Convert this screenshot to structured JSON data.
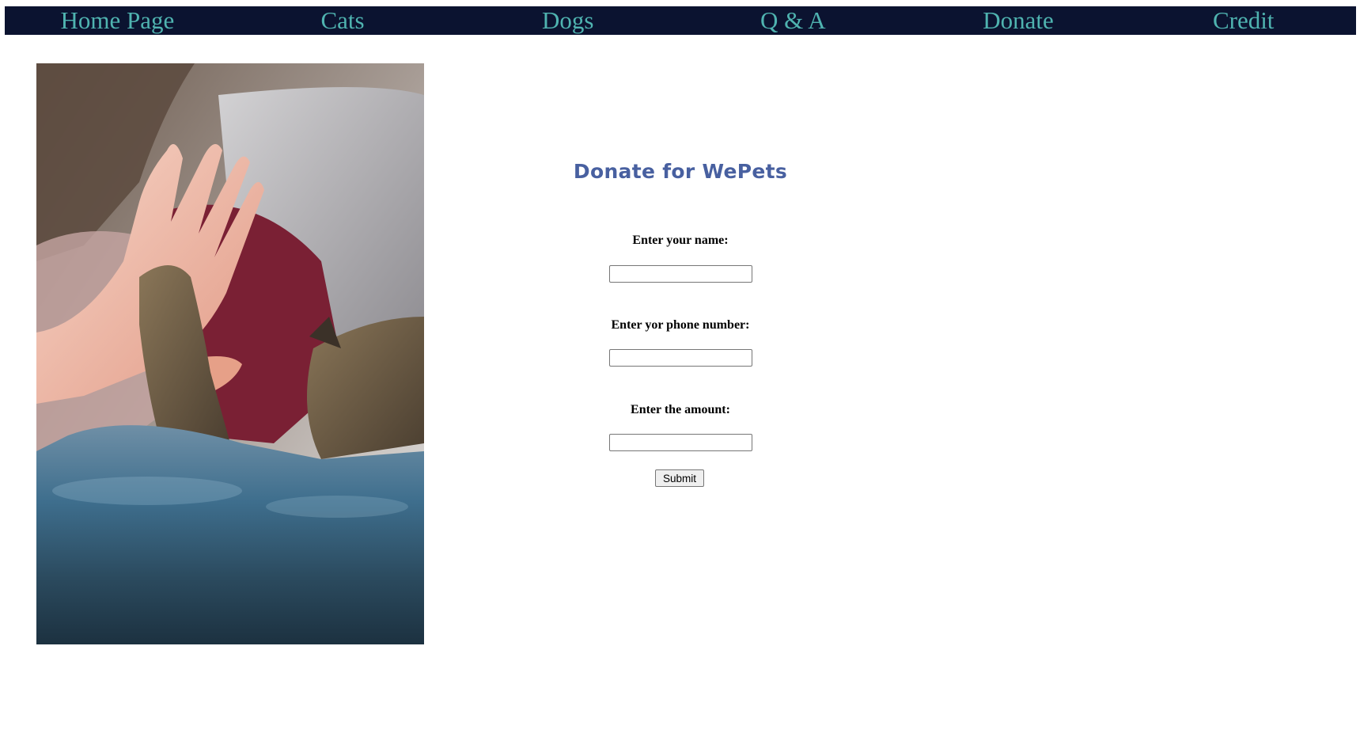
{
  "nav": {
    "items": [
      {
        "label": "Home Page"
      },
      {
        "label": "Cats"
      },
      {
        "label": "Dogs"
      },
      {
        "label": "Q & A"
      },
      {
        "label": "Donate"
      },
      {
        "label": "Credit"
      }
    ]
  },
  "colors": {
    "nav_background": "#0b1330",
    "nav_text": "#4fb3b0",
    "title": "#4860a0"
  },
  "image": {
    "alt": "person high-fiving a cat's paw"
  },
  "form": {
    "title": "Donate for WePets",
    "name_label": "Enter your name:",
    "name_value": "",
    "phone_label": "Enter yor phone number:",
    "phone_value": "",
    "amount_label": "Enter the amount:",
    "amount_value": "",
    "submit_label": "Submit"
  }
}
